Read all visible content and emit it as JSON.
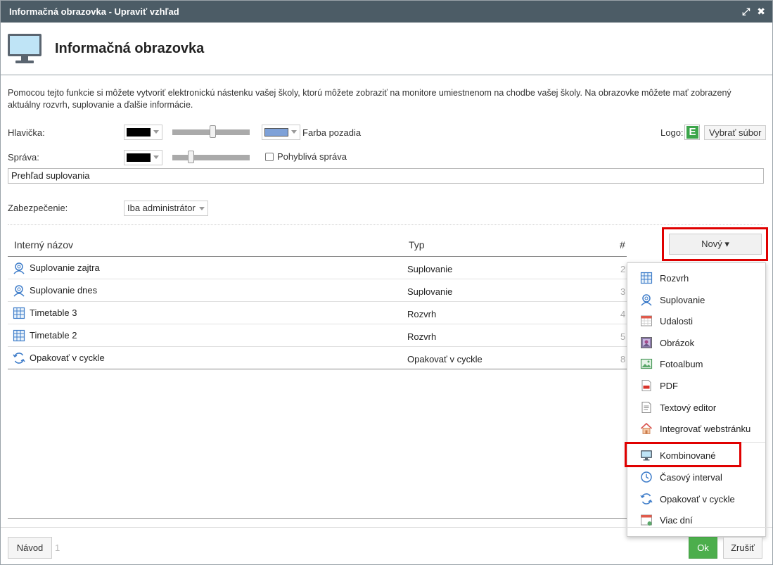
{
  "window": {
    "title": "Informačná obrazovka - Upraviť vzhľad",
    "maximize_glyph": "⤢",
    "close_glyph": "✖"
  },
  "header": {
    "title": "Informačná obrazovka",
    "icon": "monitor-icon"
  },
  "description": "Pomocou tejto funkcie si môžete vytvoriť elektronickú nástenku vašej školy, ktorú môžete zobraziť na monitore umiestnenom na chodbe vašej školy. Na obrazovke môžete mať zobrazený aktuálny rozvrh, suplovanie a ďalšie informácie.",
  "settings": {
    "header_label": "Hlavička:",
    "header_text_color": "#000000",
    "header_slider_level": 0.6,
    "background_color": "#7ea1d8",
    "background_label": "Farba pozadia",
    "logo_label": "Logo:",
    "logo_letter": "E",
    "logo_color": "#3ba54a",
    "choose_file_label": "Vybrať súbor",
    "message_label": "Správa:",
    "message_color": "#000000",
    "message_slider_level": 0.25,
    "moving_message_label": "Pohyblivá správa",
    "moving_message_checked": false,
    "message_value": "Prehľad suplovania",
    "security_label": "Zabezpečenie:",
    "security_value": "Iba administrátor"
  },
  "table": {
    "columns": [
      "Interný názov",
      "Typ",
      "#"
    ],
    "new_button": "Nový ▾",
    "rows": [
      {
        "icon": "substitution-icon",
        "name": "Suplovanie zajtra",
        "type": "Suplovanie",
        "num": "2"
      },
      {
        "icon": "substitution-icon",
        "name": "Suplovanie dnes",
        "type": "Suplovanie",
        "num": "3"
      },
      {
        "icon": "timetable-icon",
        "name": "Timetable 3",
        "type": "Rozvrh",
        "num": "4"
      },
      {
        "icon": "timetable-icon",
        "name": "Timetable 2",
        "type": "Rozvrh",
        "num": "5"
      },
      {
        "icon": "repeat-icon",
        "name": "Opakovať v cyckle",
        "type": "Opakovať v cyckle",
        "num": "8"
      }
    ]
  },
  "dropdown": {
    "items": [
      {
        "icon": "timetable-icon",
        "label": "Rozvrh"
      },
      {
        "icon": "substitution-icon",
        "label": "Suplovanie"
      },
      {
        "icon": "calendar-icon",
        "label": "Udalosti"
      },
      {
        "icon": "image-icon",
        "label": "Obrázok"
      },
      {
        "icon": "photo-album-icon",
        "label": "Fotoalbum"
      },
      {
        "icon": "pdf-icon",
        "label": "PDF"
      },
      {
        "icon": "text-editor-icon",
        "label": "Textový editor"
      },
      {
        "icon": "webpage-icon",
        "label": "Integrovať webstránku"
      },
      {
        "icon": "monitor-icon",
        "label": "Kombinované"
      },
      {
        "icon": "clock-icon",
        "label": "Časový interval"
      },
      {
        "icon": "repeat-icon",
        "label": "Opakovať v cyckle"
      },
      {
        "icon": "multi-day-icon",
        "label": "Viac dní"
      }
    ]
  },
  "footer": {
    "help_button": "Návod",
    "page_number": "1",
    "ok_button": "Ok",
    "cancel_button": "Zrušiť"
  },
  "colors": {
    "titlebar": "#4c5c66",
    "highlight": "#e00000",
    "ok": "#4cae4c"
  }
}
